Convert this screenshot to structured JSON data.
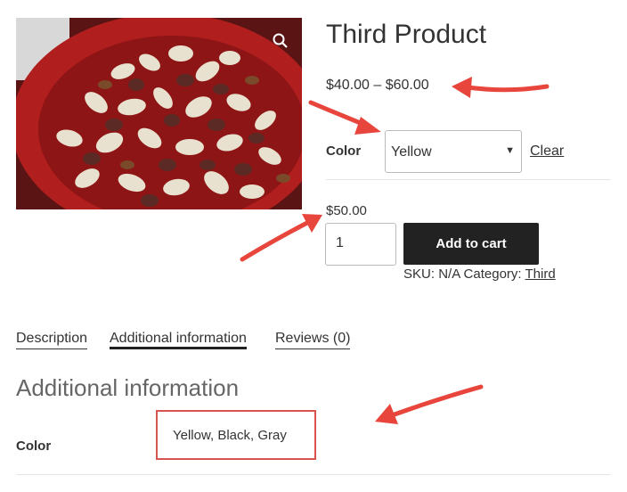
{
  "product": {
    "title": "Third Product",
    "price_range": "$40.00 – $60.00",
    "image_alt": "Bowl of mixed nuts"
  },
  "variations": {
    "label": "Color",
    "selected": "Yellow",
    "clear_label": "Clear"
  },
  "variation_price": "$50.00",
  "cart": {
    "quantity": "1",
    "add_to_cart_label": "Add to cart"
  },
  "meta": {
    "sku_label": "SKU:",
    "sku_value": "N/A",
    "category_label": "Category:",
    "category_value": "Third"
  },
  "tabs": [
    {
      "label": "Description"
    },
    {
      "label": "Additional information",
      "active": true
    },
    {
      "label": "Reviews (0)"
    }
  ],
  "additional_info": {
    "heading": "Additional information",
    "attributes": [
      {
        "label": "Color",
        "value": "Yellow, Black, Gray"
      }
    ]
  },
  "colors": {
    "text": "#333333",
    "button_bg": "#222222",
    "annotation_red": "#e8453c",
    "heading_gray": "#666666"
  },
  "icons": {
    "zoom": "magnifier-icon"
  }
}
